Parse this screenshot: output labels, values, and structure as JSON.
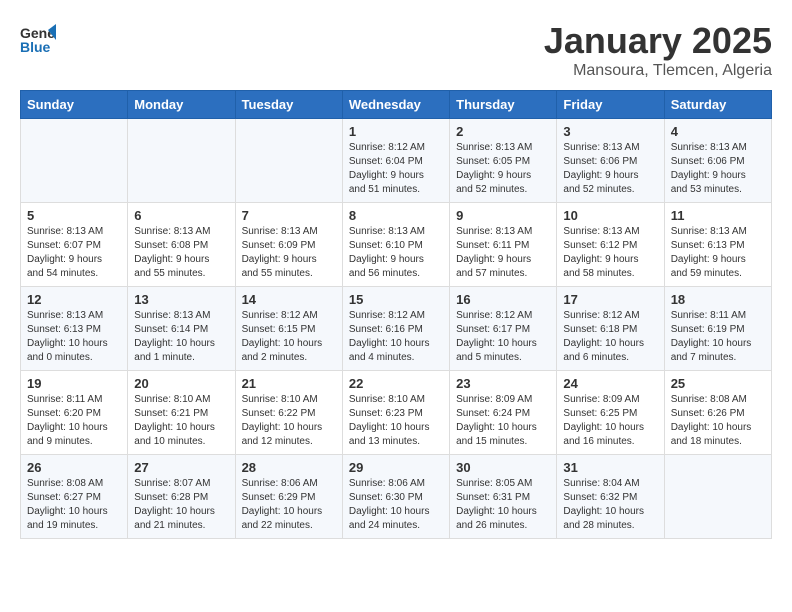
{
  "header": {
    "logo_general": "General",
    "logo_blue": "Blue",
    "month_title": "January 2025",
    "subtitle": "Mansoura, Tlemcen, Algeria"
  },
  "days_of_week": [
    "Sunday",
    "Monday",
    "Tuesday",
    "Wednesday",
    "Thursday",
    "Friday",
    "Saturday"
  ],
  "weeks": [
    [
      {
        "day": "",
        "text": ""
      },
      {
        "day": "",
        "text": ""
      },
      {
        "day": "",
        "text": ""
      },
      {
        "day": "1",
        "text": "Sunrise: 8:12 AM\nSunset: 6:04 PM\nDaylight: 9 hours\nand 51 minutes."
      },
      {
        "day": "2",
        "text": "Sunrise: 8:13 AM\nSunset: 6:05 PM\nDaylight: 9 hours\nand 52 minutes."
      },
      {
        "day": "3",
        "text": "Sunrise: 8:13 AM\nSunset: 6:06 PM\nDaylight: 9 hours\nand 52 minutes."
      },
      {
        "day": "4",
        "text": "Sunrise: 8:13 AM\nSunset: 6:06 PM\nDaylight: 9 hours\nand 53 minutes."
      }
    ],
    [
      {
        "day": "5",
        "text": "Sunrise: 8:13 AM\nSunset: 6:07 PM\nDaylight: 9 hours\nand 54 minutes."
      },
      {
        "day": "6",
        "text": "Sunrise: 8:13 AM\nSunset: 6:08 PM\nDaylight: 9 hours\nand 55 minutes."
      },
      {
        "day": "7",
        "text": "Sunrise: 8:13 AM\nSunset: 6:09 PM\nDaylight: 9 hours\nand 55 minutes."
      },
      {
        "day": "8",
        "text": "Sunrise: 8:13 AM\nSunset: 6:10 PM\nDaylight: 9 hours\nand 56 minutes."
      },
      {
        "day": "9",
        "text": "Sunrise: 8:13 AM\nSunset: 6:11 PM\nDaylight: 9 hours\nand 57 minutes."
      },
      {
        "day": "10",
        "text": "Sunrise: 8:13 AM\nSunset: 6:12 PM\nDaylight: 9 hours\nand 58 minutes."
      },
      {
        "day": "11",
        "text": "Sunrise: 8:13 AM\nSunset: 6:13 PM\nDaylight: 9 hours\nand 59 minutes."
      }
    ],
    [
      {
        "day": "12",
        "text": "Sunrise: 8:13 AM\nSunset: 6:13 PM\nDaylight: 10 hours\nand 0 minutes."
      },
      {
        "day": "13",
        "text": "Sunrise: 8:13 AM\nSunset: 6:14 PM\nDaylight: 10 hours\nand 1 minute."
      },
      {
        "day": "14",
        "text": "Sunrise: 8:12 AM\nSunset: 6:15 PM\nDaylight: 10 hours\nand 2 minutes."
      },
      {
        "day": "15",
        "text": "Sunrise: 8:12 AM\nSunset: 6:16 PM\nDaylight: 10 hours\nand 4 minutes."
      },
      {
        "day": "16",
        "text": "Sunrise: 8:12 AM\nSunset: 6:17 PM\nDaylight: 10 hours\nand 5 minutes."
      },
      {
        "day": "17",
        "text": "Sunrise: 8:12 AM\nSunset: 6:18 PM\nDaylight: 10 hours\nand 6 minutes."
      },
      {
        "day": "18",
        "text": "Sunrise: 8:11 AM\nSunset: 6:19 PM\nDaylight: 10 hours\nand 7 minutes."
      }
    ],
    [
      {
        "day": "19",
        "text": "Sunrise: 8:11 AM\nSunset: 6:20 PM\nDaylight: 10 hours\nand 9 minutes."
      },
      {
        "day": "20",
        "text": "Sunrise: 8:10 AM\nSunset: 6:21 PM\nDaylight: 10 hours\nand 10 minutes."
      },
      {
        "day": "21",
        "text": "Sunrise: 8:10 AM\nSunset: 6:22 PM\nDaylight: 10 hours\nand 12 minutes."
      },
      {
        "day": "22",
        "text": "Sunrise: 8:10 AM\nSunset: 6:23 PM\nDaylight: 10 hours\nand 13 minutes."
      },
      {
        "day": "23",
        "text": "Sunrise: 8:09 AM\nSunset: 6:24 PM\nDaylight: 10 hours\nand 15 minutes."
      },
      {
        "day": "24",
        "text": "Sunrise: 8:09 AM\nSunset: 6:25 PM\nDaylight: 10 hours\nand 16 minutes."
      },
      {
        "day": "25",
        "text": "Sunrise: 8:08 AM\nSunset: 6:26 PM\nDaylight: 10 hours\nand 18 minutes."
      }
    ],
    [
      {
        "day": "26",
        "text": "Sunrise: 8:08 AM\nSunset: 6:27 PM\nDaylight: 10 hours\nand 19 minutes."
      },
      {
        "day": "27",
        "text": "Sunrise: 8:07 AM\nSunset: 6:28 PM\nDaylight: 10 hours\nand 21 minutes."
      },
      {
        "day": "28",
        "text": "Sunrise: 8:06 AM\nSunset: 6:29 PM\nDaylight: 10 hours\nand 22 minutes."
      },
      {
        "day": "29",
        "text": "Sunrise: 8:06 AM\nSunset: 6:30 PM\nDaylight: 10 hours\nand 24 minutes."
      },
      {
        "day": "30",
        "text": "Sunrise: 8:05 AM\nSunset: 6:31 PM\nDaylight: 10 hours\nand 26 minutes."
      },
      {
        "day": "31",
        "text": "Sunrise: 8:04 AM\nSunset: 6:32 PM\nDaylight: 10 hours\nand 28 minutes."
      },
      {
        "day": "",
        "text": ""
      }
    ]
  ]
}
